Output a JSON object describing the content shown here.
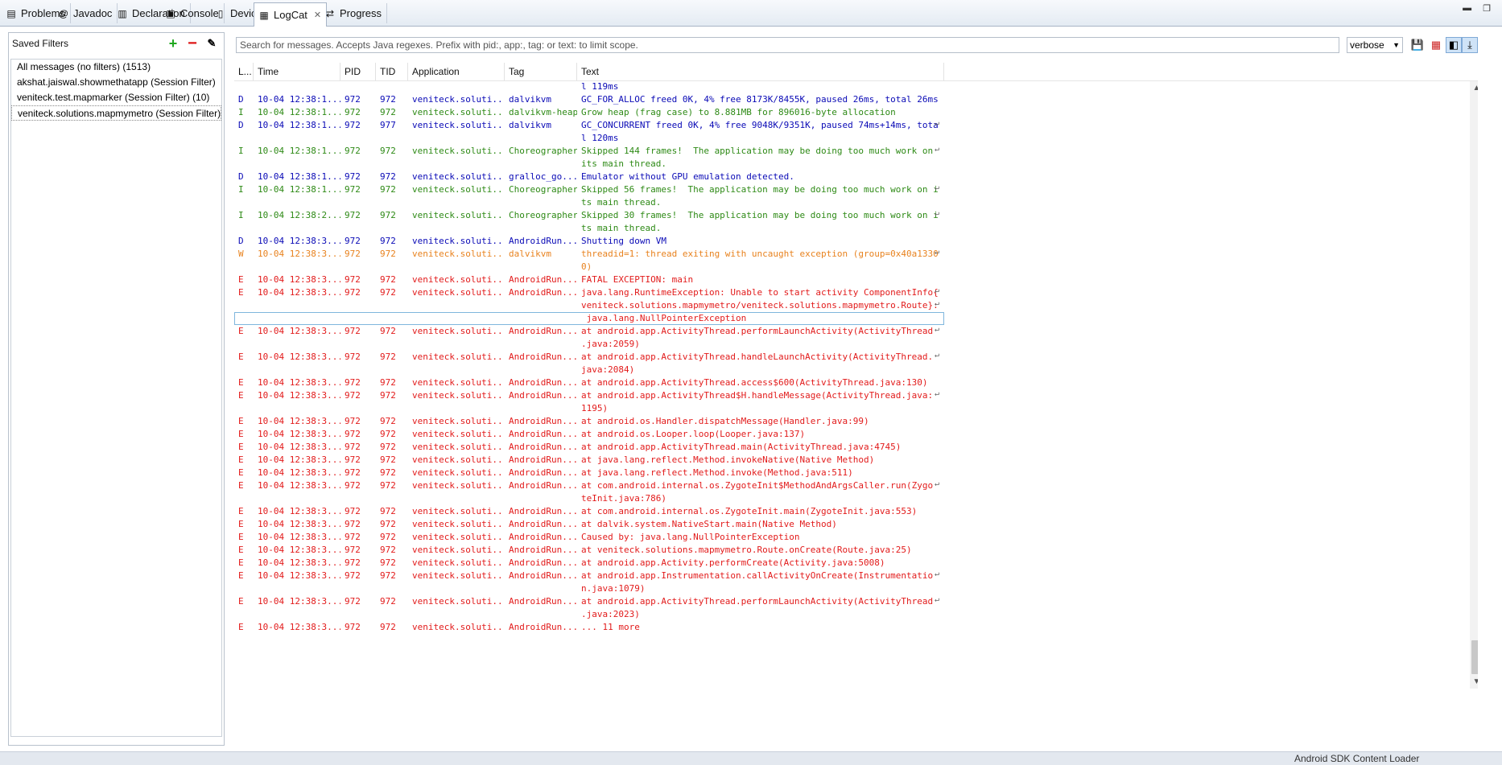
{
  "tabs": [
    {
      "label": "Problems",
      "icon": "problems-icon",
      "glyph": "▤"
    },
    {
      "label": "Javadoc",
      "icon": "at-icon",
      "glyph": "@"
    },
    {
      "label": "Declaration",
      "icon": "declaration-icon",
      "glyph": "▥"
    },
    {
      "label": "Console",
      "icon": "console-icon",
      "glyph": "▣"
    },
    {
      "label": "Devices",
      "icon": "phone-icon",
      "glyph": "▯"
    },
    {
      "label": "LogCat",
      "icon": "logcat-icon",
      "glyph": "▦"
    },
    {
      "label": "Progress",
      "icon": "progress-icon",
      "glyph": "⇄"
    }
  ],
  "saved_filters": {
    "title": "Saved Filters",
    "items": [
      "All messages (no filters) (1513)",
      "akshat.jaiswal.showmethatapp (Session Filter)",
      "veniteck.test.mapmarker (Session Filter) (10)",
      "veniteck.solutions.mapmymetro (Session Filter)"
    ],
    "selected_index": 3
  },
  "search": {
    "placeholder": "Search for messages. Accepts Java regexes. Prefix with pid:, app:, tag: or text: to limit scope.",
    "value": ""
  },
  "level": "verbose",
  "columns": [
    "L...",
    "Time",
    "PID",
    "TID",
    "Application",
    "Tag",
    "Text"
  ],
  "rows": [
    {
      "level": "D",
      "time": "",
      "pid": "",
      "tid": "",
      "app": "",
      "tag": "",
      "text": "l 119ms",
      "wrap": false
    },
    {
      "level": "D",
      "time": "10-04 12:38:1...",
      "pid": "972",
      "tid": "972",
      "app": "veniteck.soluti...",
      "tag": "dalvikvm",
      "text": "GC_FOR_ALLOC freed 0K, 4% free 8173K/8455K, paused 26ms, total 26ms",
      "wrap": false
    },
    {
      "level": "I",
      "time": "10-04 12:38:1...",
      "pid": "972",
      "tid": "972",
      "app": "veniteck.soluti...",
      "tag": "dalvikvm-heap",
      "text": "Grow heap (frag case) to 8.881MB for 896016-byte allocation",
      "wrap": false
    },
    {
      "level": "D",
      "time": "10-04 12:38:1...",
      "pid": "972",
      "tid": "977",
      "app": "veniteck.soluti...",
      "tag": "dalvikvm",
      "text": "GC_CONCURRENT freed 0K, 4% free 9048K/9351K, paused 74ms+14ms, tota\nl 120ms",
      "wrap": true
    },
    {
      "level": "I",
      "time": "10-04 12:38:1...",
      "pid": "972",
      "tid": "972",
      "app": "veniteck.soluti...",
      "tag": "Choreographer",
      "text": "Skipped 144 frames!  The application may be doing too much work on \nits main thread.",
      "wrap": true
    },
    {
      "level": "D",
      "time": "10-04 12:38:1...",
      "pid": "972",
      "tid": "972",
      "app": "veniteck.soluti...",
      "tag": "gralloc_go...",
      "text": "Emulator without GPU emulation detected.",
      "wrap": false
    },
    {
      "level": "I",
      "time": "10-04 12:38:1...",
      "pid": "972",
      "tid": "972",
      "app": "veniteck.soluti...",
      "tag": "Choreographer",
      "text": "Skipped 56 frames!  The application may be doing too much work on i\nts main thread.",
      "wrap": true
    },
    {
      "level": "I",
      "time": "10-04 12:38:2...",
      "pid": "972",
      "tid": "972",
      "app": "veniteck.soluti...",
      "tag": "Choreographer",
      "text": "Skipped 30 frames!  The application may be doing too much work on i\nts main thread.",
      "wrap": true
    },
    {
      "level": "D",
      "time": "10-04 12:38:3...",
      "pid": "972",
      "tid": "972",
      "app": "veniteck.soluti...",
      "tag": "AndroidRun...",
      "text": "Shutting down VM",
      "wrap": false
    },
    {
      "level": "W",
      "time": "10-04 12:38:3...",
      "pid": "972",
      "tid": "972",
      "app": "veniteck.soluti...",
      "tag": "dalvikvm",
      "text": "threadid=1: thread exiting with uncaught exception (group=0x40a1330\n0)",
      "wrap": true
    },
    {
      "level": "E",
      "time": "10-04 12:38:3...",
      "pid": "972",
      "tid": "972",
      "app": "veniteck.soluti...",
      "tag": "AndroidRun...",
      "text": "FATAL EXCEPTION: main",
      "wrap": false
    },
    {
      "level": "E",
      "time": "10-04 12:38:3...",
      "pid": "972",
      "tid": "972",
      "app": "veniteck.soluti...",
      "tag": "AndroidRun...",
      "text": "java.lang.RuntimeException: Unable to start activity ComponentInfo{\nveniteck.solutions.mapmymetro/veniteck.solutions.mapmymetro.Route}:\n java.lang.NullPointerException",
      "wrap": true,
      "wrap2": true
    },
    {
      "level": "E",
      "time": "10-04 12:38:3...",
      "pid": "972",
      "tid": "972",
      "app": "veniteck.soluti...",
      "tag": "AndroidRun...",
      "text": "at android.app.ActivityThread.performLaunchActivity(ActivityThread\n.java:2059)",
      "wrap": true
    },
    {
      "level": "E",
      "time": "10-04 12:38:3...",
      "pid": "972",
      "tid": "972",
      "app": "veniteck.soluti...",
      "tag": "AndroidRun...",
      "text": "at android.app.ActivityThread.handleLaunchActivity(ActivityThread.\njava:2084)",
      "wrap": true
    },
    {
      "level": "E",
      "time": "10-04 12:38:3...",
      "pid": "972",
      "tid": "972",
      "app": "veniteck.soluti...",
      "tag": "AndroidRun...",
      "text": "at android.app.ActivityThread.access$600(ActivityThread.java:130)",
      "wrap": false
    },
    {
      "level": "E",
      "time": "10-04 12:38:3...",
      "pid": "972",
      "tid": "972",
      "app": "veniteck.soluti...",
      "tag": "AndroidRun...",
      "text": "at android.app.ActivityThread$H.handleMessage(ActivityThread.java:\n1195)",
      "wrap": true
    },
    {
      "level": "E",
      "time": "10-04 12:38:3...",
      "pid": "972",
      "tid": "972",
      "app": "veniteck.soluti...",
      "tag": "AndroidRun...",
      "text": "at android.os.Handler.dispatchMessage(Handler.java:99)",
      "wrap": false
    },
    {
      "level": "E",
      "time": "10-04 12:38:3...",
      "pid": "972",
      "tid": "972",
      "app": "veniteck.soluti...",
      "tag": "AndroidRun...",
      "text": "at android.os.Looper.loop(Looper.java:137)",
      "wrap": false
    },
    {
      "level": "E",
      "time": "10-04 12:38:3...",
      "pid": "972",
      "tid": "972",
      "app": "veniteck.soluti...",
      "tag": "AndroidRun...",
      "text": "at android.app.ActivityThread.main(ActivityThread.java:4745)",
      "wrap": false
    },
    {
      "level": "E",
      "time": "10-04 12:38:3...",
      "pid": "972",
      "tid": "972",
      "app": "veniteck.soluti...",
      "tag": "AndroidRun...",
      "text": "at java.lang.reflect.Method.invokeNative(Native Method)",
      "wrap": false
    },
    {
      "level": "E",
      "time": "10-04 12:38:3...",
      "pid": "972",
      "tid": "972",
      "app": "veniteck.soluti...",
      "tag": "AndroidRun...",
      "text": "at java.lang.reflect.Method.invoke(Method.java:511)",
      "wrap": false
    },
    {
      "level": "E",
      "time": "10-04 12:38:3...",
      "pid": "972",
      "tid": "972",
      "app": "veniteck.soluti...",
      "tag": "AndroidRun...",
      "text": "at com.android.internal.os.ZygoteInit$MethodAndArgsCaller.run(Zygo\nteInit.java:786)",
      "wrap": true
    },
    {
      "level": "E",
      "time": "10-04 12:38:3...",
      "pid": "972",
      "tid": "972",
      "app": "veniteck.soluti...",
      "tag": "AndroidRun...",
      "text": "at com.android.internal.os.ZygoteInit.main(ZygoteInit.java:553)",
      "wrap": false
    },
    {
      "level": "E",
      "time": "10-04 12:38:3...",
      "pid": "972",
      "tid": "972",
      "app": "veniteck.soluti...",
      "tag": "AndroidRun...",
      "text": "at dalvik.system.NativeStart.main(Native Method)",
      "wrap": false
    },
    {
      "level": "E",
      "time": "10-04 12:38:3...",
      "pid": "972",
      "tid": "972",
      "app": "veniteck.soluti...",
      "tag": "AndroidRun...",
      "text": "Caused by: java.lang.NullPointerException",
      "wrap": false
    },
    {
      "level": "E",
      "time": "10-04 12:38:3...",
      "pid": "972",
      "tid": "972",
      "app": "veniteck.soluti...",
      "tag": "AndroidRun...",
      "text": "at veniteck.solutions.mapmymetro.Route.onCreate(Route.java:25)",
      "wrap": false
    },
    {
      "level": "E",
      "time": "10-04 12:38:3...",
      "pid": "972",
      "tid": "972",
      "app": "veniteck.soluti...",
      "tag": "AndroidRun...",
      "text": "at android.app.Activity.performCreate(Activity.java:5008)",
      "wrap": false
    },
    {
      "level": "E",
      "time": "10-04 12:38:3...",
      "pid": "972",
      "tid": "972",
      "app": "veniteck.soluti...",
      "tag": "AndroidRun...",
      "text": "at android.app.Instrumentation.callActivityOnCreate(Instrumentatio\nn.java:1079)",
      "wrap": true
    },
    {
      "level": "E",
      "time": "10-04 12:38:3...",
      "pid": "972",
      "tid": "972",
      "app": "veniteck.soluti...",
      "tag": "AndroidRun...",
      "text": "at android.app.ActivityThread.performLaunchActivity(ActivityThread\n.java:2023)",
      "wrap": true
    },
    {
      "level": "E",
      "time": "10-04 12:38:3...",
      "pid": "972",
      "tid": "972",
      "app": "veniteck.soluti...",
      "tag": "AndroidRun...",
      "text": "... 11 more",
      "wrap": false
    }
  ],
  "status": {
    "text": "Android SDK Content Loader"
  },
  "colors": {
    "D": "#0a0ab6",
    "I": "#2e8a16",
    "W": "#e8821e",
    "E": "#e21b1b",
    "selection_border": "#7fb6dd"
  }
}
